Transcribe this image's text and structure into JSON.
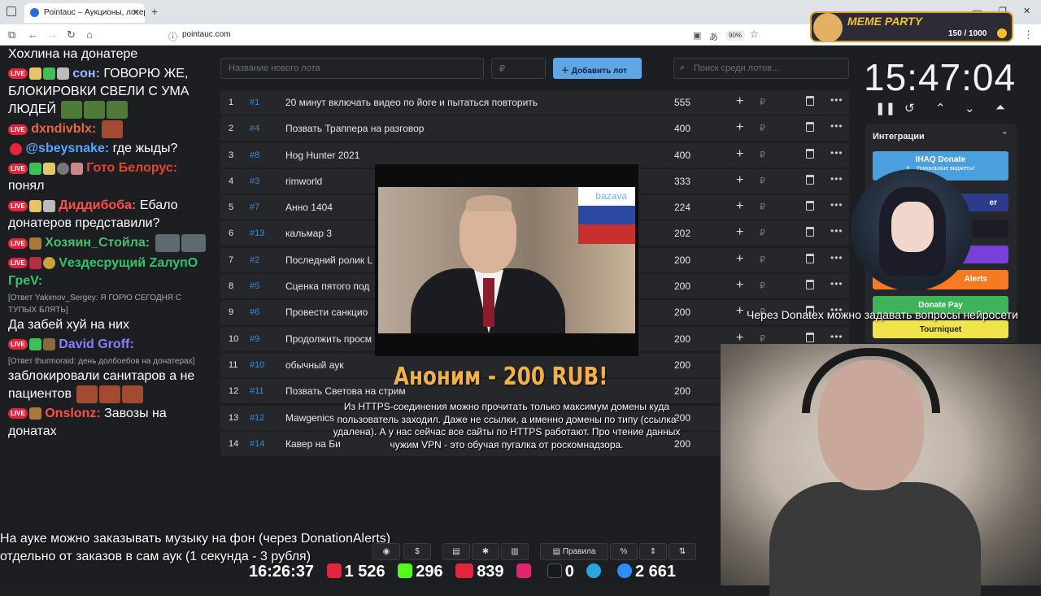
{
  "browser": {
    "tab_title": "Pointauc – Аукционы, лотереи",
    "url": "pointauc.com",
    "zoom": "90%"
  },
  "chat": {
    "messages": [
      {
        "nick": "",
        "text": "Хохлина на донатере",
        "color": "#ffffff"
      },
      {
        "nick": "сон:",
        "text": "ГОВОРЮ ЖЕ, БЛОКИРОВКИ СВЕЛИ С УМА ЛЮДЕЙ",
        "color": "#9fb6ff"
      },
      {
        "nick": "dxndivblx:",
        "text": "",
        "color": "#e8693a"
      },
      {
        "nick": "@sbeysnake:",
        "text": "где жыды?",
        "color": "#5aa5ff"
      },
      {
        "nick": "Гото Белорус:",
        "text": "понял",
        "color": "#e0472e"
      },
      {
        "nick": "Диддибоба:",
        "text": "Ебало донатеров представили?",
        "color": "#ff4d4d"
      },
      {
        "nick": "Хозяин_Стойла:",
        "text": "",
        "color": "#45c16a"
      },
      {
        "nick": "Vездесрущий ZалупО ГреV:",
        "text": "",
        "color": "#32c46b"
      },
      {
        "reply": "[Ответ Yakimov_Sergey: Я ГОРЮ СЕГОДНЯ С ТУПЫХ БЛЯТЬ]",
        "text": "Да забей хуй на них"
      },
      {
        "nick": "David Groff:",
        "text": "",
        "color": "#8a7dff"
      },
      {
        "reply": "[Ответ thurmoraid: день долбоебов на донатерах]",
        "text": "заблокировали санитаров а не пациентов"
      },
      {
        "nick": "Onslonz:",
        "text": "Завозы на донатах",
        "color": "#ff5050"
      }
    ],
    "live_label": "LIVE"
  },
  "auction": {
    "new_lot_placeholder": "Название нового лота",
    "amount_placeholder": "₽",
    "add_button": "Добавить лот",
    "search_placeholder": "Поиск среди лотов...",
    "currency": "₽",
    "lots": [
      {
        "n": "1",
        "id": "#1",
        "name": "20 минут включать видео по йоге и пытаться повторить",
        "amount": "555"
      },
      {
        "n": "2",
        "id": "#4",
        "name": "Позвать Траппера на разговор",
        "amount": "400"
      },
      {
        "n": "3",
        "id": "#8",
        "name": "Hog Hunter 2021",
        "amount": "400"
      },
      {
        "n": "4",
        "id": "#3",
        "name": "rimworld",
        "amount": "333"
      },
      {
        "n": "5",
        "id": "#7",
        "name": "Анно 1404",
        "amount": "224"
      },
      {
        "n": "6",
        "id": "#13",
        "name": "кальмар 3",
        "amount": "202"
      },
      {
        "n": "7",
        "id": "#2",
        "name": "Последний ролик L",
        "amount": "200"
      },
      {
        "n": "8",
        "id": "#5",
        "name": "Сценка пятого под",
        "amount": "200"
      },
      {
        "n": "9",
        "id": "#6",
        "name": "Провести санкцио",
        "amount": "200"
      },
      {
        "n": "10",
        "id": "#9",
        "name": "Продолжить просм",
        "amount": "200"
      },
      {
        "n": "11",
        "id": "#10",
        "name": "обычный аук",
        "amount": "200"
      },
      {
        "n": "12",
        "id": "#11",
        "name": "Позвать Светова на стрим",
        "amount": "200"
      },
      {
        "n": "13",
        "id": "#12",
        "name": "Mawgenics",
        "amount": "200"
      },
      {
        "n": "14",
        "id": "#14",
        "name": "Кавер на Би",
        "amount": "200"
      }
    ],
    "toolbar": {
      "rules": "Правила",
      "percent": "%"
    }
  },
  "timer": {
    "value": "15:47:04"
  },
  "integrations": {
    "title": "Интеграции",
    "buttons": [
      "IHAQ Donate",
      "Alerts",
      "Donate Pay",
      "Tourniquet"
    ],
    "ihaq_sub": "К... Уникальные виджеты!",
    "partial": "er"
  },
  "overlay": {
    "video_watermark": "bazava",
    "donation_title": "Аноним - 200 RUB!",
    "donation_message": "Из HTTPS-соединения можно прочитать только максимум домены куда пользователь заходил. Даже не ссылки, а именно домены по типу (ссылка удалена). А у нас сейчас все сайты по HTTPS работают. Про чтение данных чужим VPN - это обучая пугалка от роскомнадзора.",
    "ticker_right": "Через Donatex можно задавать вопросы нейросети",
    "ticker_bottom_1": "На ауке можно заказывать музыку на фон (через DonationAlerts)",
    "ticker_bottom_2": "отдельно от заказов в сам аук (1 секунда - 3 рубля)"
  },
  "stats": {
    "time": "16:26:37",
    "youtube": "1 526",
    "kick": "296",
    "vk_live": "839",
    "rutube": "",
    "r_count": "0",
    "total": "2 661"
  },
  "meme_party": {
    "title": "MEME PARTY",
    "progress": "150 / 1000"
  },
  "colors": {
    "accent": "#5ea6e6",
    "id": "#3a8ad6",
    "donation": "#f0b04a"
  }
}
